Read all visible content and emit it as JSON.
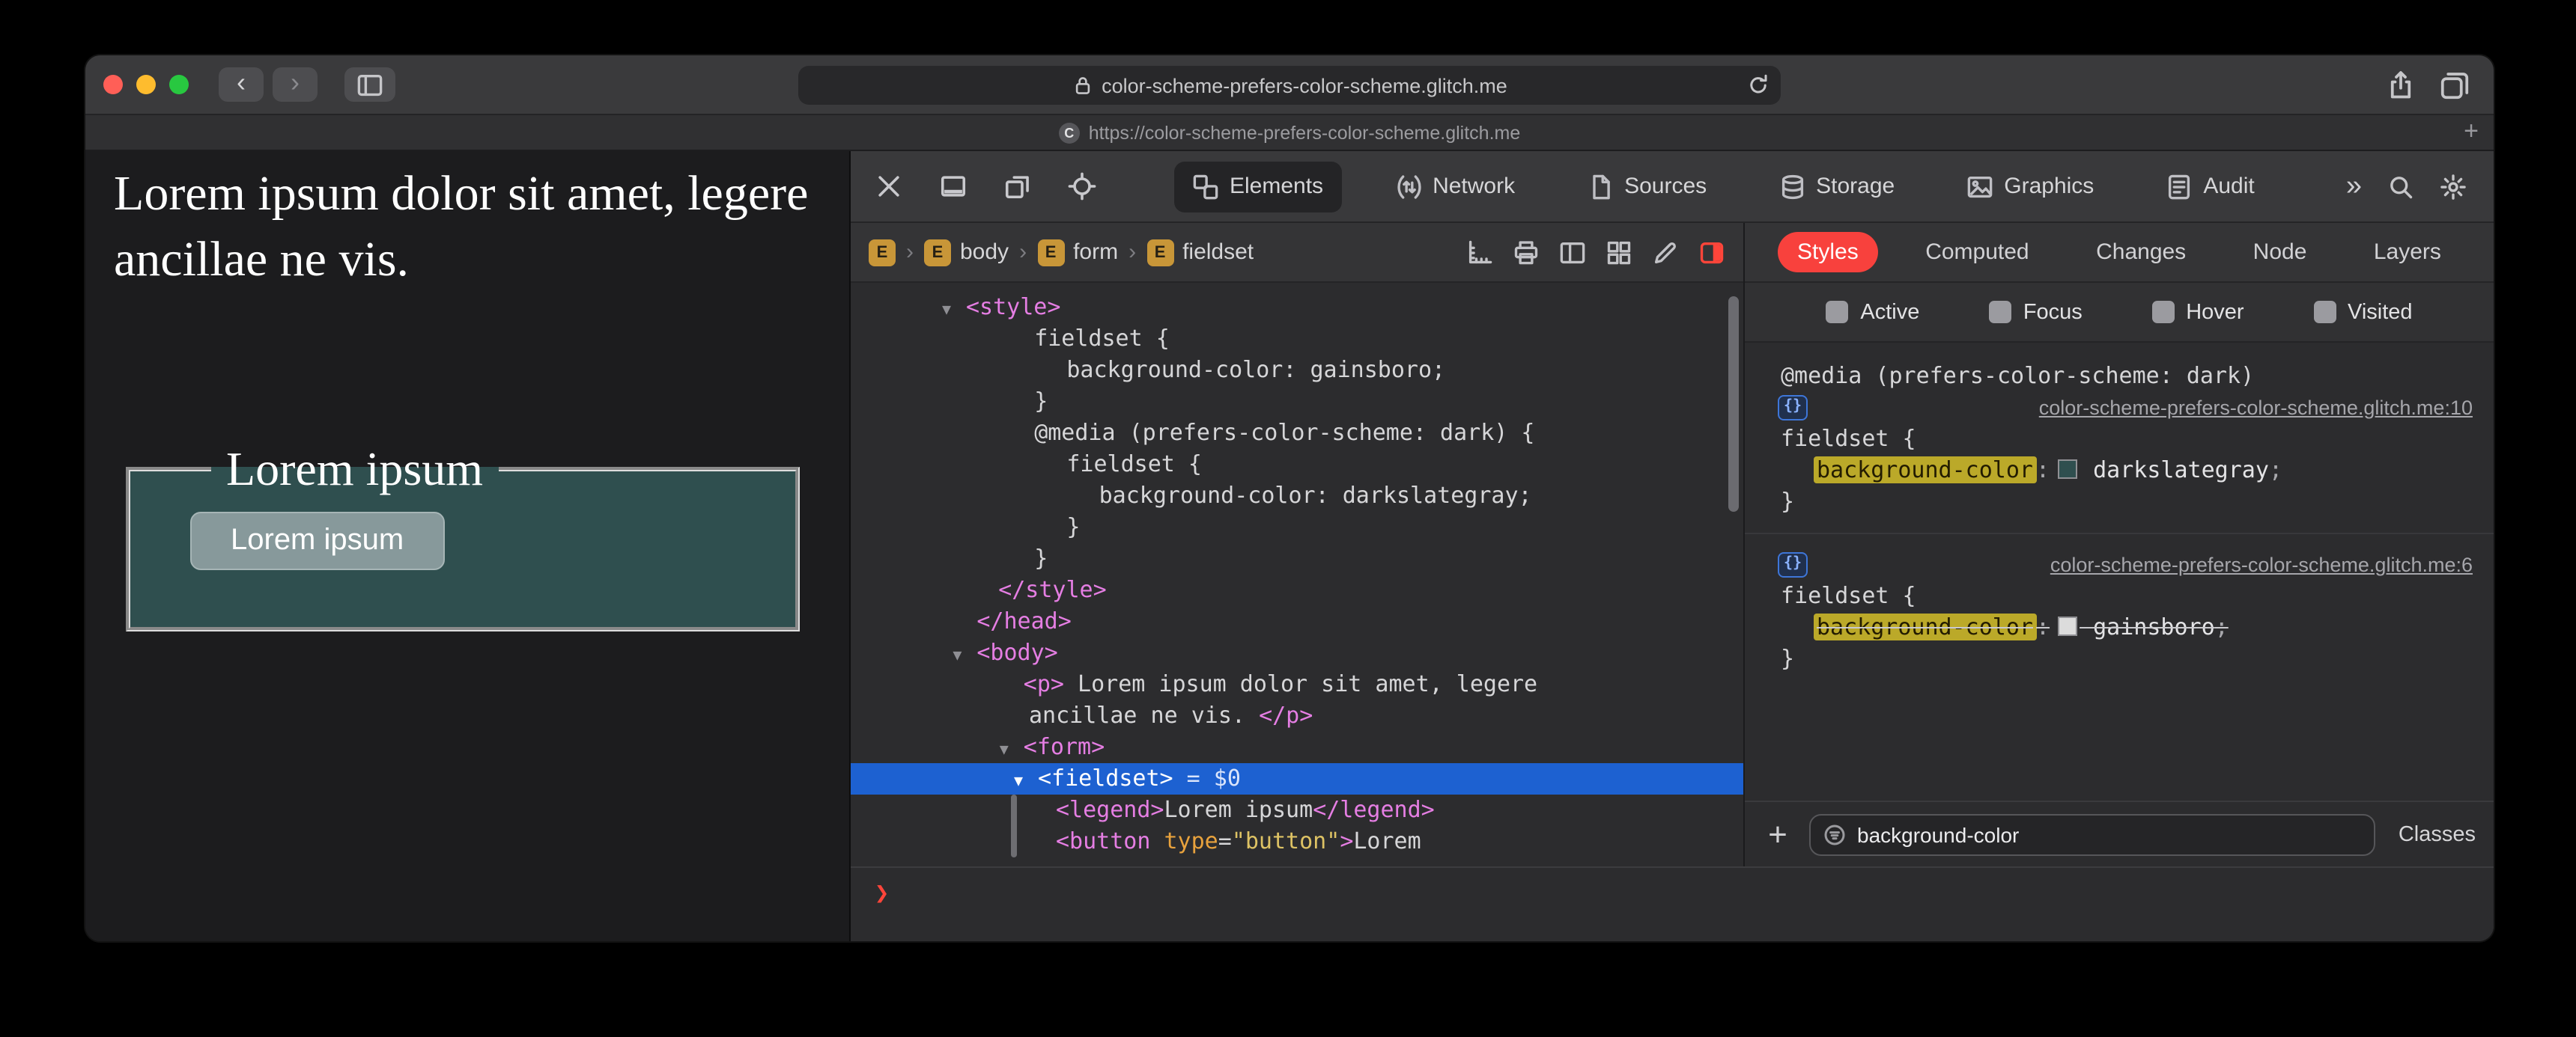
{
  "browser": {
    "traffic_lights": [
      {
        "name": "close-button",
        "color": "#ff5f57"
      },
      {
        "name": "minimize-button",
        "color": "#febc2e"
      },
      {
        "name": "zoom-button",
        "color": "#28c840"
      }
    ],
    "back": "‹",
    "forward": "›",
    "url": "color-scheme-prefers-color-scheme.glitch.me",
    "tab_title": "https://color-scheme-prefers-color-scheme.glitch.me",
    "favicon_letter": "C",
    "new_tab": "+"
  },
  "page": {
    "paragraph": "Lorem ipsum dolor sit amet, legere ancillae ne vis.",
    "legend": "Lorem ipsum",
    "button": "Lorem ipsum",
    "fieldset_bg": "#2f4f4f",
    "page_bg": "#1c1c1e"
  },
  "devtools": {
    "toolbar": {
      "left_icons": [
        {
          "name": "close-icon"
        },
        {
          "name": "dock-bottom-icon"
        },
        {
          "name": "dock-windows-icon"
        },
        {
          "name": "element-picker-icon"
        }
      ],
      "tabs": [
        {
          "label": "Elements",
          "icon": "elements-icon",
          "selected": true
        },
        {
          "label": "Network",
          "icon": "network-icon"
        },
        {
          "label": "Sources",
          "icon": "sources-icon"
        },
        {
          "label": "Storage",
          "icon": "storage-icon"
        },
        {
          "label": "Graphics",
          "icon": "graphics-icon"
        },
        {
          "label": "Audit",
          "icon": "audit-icon"
        }
      ],
      "overflow": "»",
      "right_icons": [
        {
          "name": "search-icon"
        },
        {
          "name": "settings-icon"
        }
      ]
    },
    "breadcrumb": {
      "badge": "E",
      "separator": "›",
      "items": [
        {
          "label": ""
        },
        {
          "label": "body"
        },
        {
          "label": "form"
        },
        {
          "label": "fieldset"
        }
      ],
      "right_icons": [
        {
          "name": "rulers-icon"
        },
        {
          "name": "print-icon"
        },
        {
          "name": "columns-icon"
        },
        {
          "name": "grid-icon"
        },
        {
          "name": "edit-icon"
        },
        {
          "name": "appearance-icon"
        }
      ]
    },
    "dom_tree": {
      "disclosure_glyph": "▼",
      "lines": [
        {
          "indent": 1,
          "disclosure": true,
          "segments": [
            {
              "t": "<style>",
              "c": "tag"
            }
          ]
        },
        {
          "indent": 2.9,
          "segments": [
            {
              "t": "fieldset {",
              "c": "plain"
            }
          ]
        },
        {
          "indent": 3.8,
          "segments": [
            {
              "t": "background-color: gainsboro;",
              "c": "plain"
            }
          ]
        },
        {
          "indent": 2.9,
          "segments": [
            {
              "t": "}",
              "c": "plain"
            }
          ]
        },
        {
          "indent": 2.9,
          "segments": [
            {
              "t": "@media (prefers-color-scheme: dark) {",
              "c": "plain"
            }
          ]
        },
        {
          "indent": 3.8,
          "segments": [
            {
              "t": "fieldset {",
              "c": "plain"
            }
          ]
        },
        {
          "indent": 4.7,
          "segments": [
            {
              "t": "background-color: darkslategray;",
              "c": "plain"
            }
          ]
        },
        {
          "indent": 3.8,
          "segments": [
            {
              "t": "}",
              "c": "plain"
            }
          ]
        },
        {
          "indent": 2.9,
          "segments": [
            {
              "t": "}",
              "c": "plain"
            }
          ]
        },
        {
          "indent": 1.9,
          "segments": [
            {
              "t": "</style>",
              "c": "tag"
            }
          ]
        },
        {
          "indent": 1.3,
          "segments": [
            {
              "t": "</head>",
              "c": "tag"
            }
          ]
        },
        {
          "indent": 1.3,
          "disclosure": true,
          "segments": [
            {
              "t": "<body>",
              "c": "tag"
            }
          ]
        },
        {
          "indent": 2.6,
          "segments": [
            {
              "t": "<p>",
              "c": "tag"
            },
            {
              "t": " Lorem ipsum dolor sit amet, legere",
              "c": "plain"
            }
          ]
        },
        {
          "indent": 2.75,
          "segments": [
            {
              "t": "ancillae ne vis. ",
              "c": "plain"
            },
            {
              "t": "</p>",
              "c": "tag"
            }
          ]
        },
        {
          "indent": 2.6,
          "disclosure": true,
          "segments": [
            {
              "t": "<form>",
              "c": "tag"
            }
          ]
        },
        {
          "indent": 3.0,
          "disclosure": true,
          "selected": true,
          "segments": [
            {
              "t": "<fieldset>",
              "c": "sel"
            },
            {
              "t": " = $0",
              "c": "seldim"
            }
          ]
        },
        {
          "indent": 3.5,
          "segments": [
            {
              "t": "<legend>",
              "c": "tag"
            },
            {
              "t": "Lorem ipsum",
              "c": "plain"
            },
            {
              "t": "</legend>",
              "c": "tag"
            }
          ]
        },
        {
          "indent": 3.5,
          "segments": [
            {
              "t": "<button ",
              "c": "tag"
            },
            {
              "t": "type",
              "c": "attr"
            },
            {
              "t": "=",
              "c": "plain"
            },
            {
              "t": "\"button\"",
              "c": "val"
            },
            {
              "t": ">",
              "c": "tag"
            },
            {
              "t": "Lorem",
              "c": "plain"
            }
          ]
        }
      ]
    },
    "console_prompt": "❯",
    "sidebar": {
      "tabs": [
        {
          "label": "Styles",
          "selected": true
        },
        {
          "label": "Computed"
        },
        {
          "label": "Changes"
        },
        {
          "label": "Node"
        },
        {
          "label": "Layers"
        }
      ],
      "pseudo": [
        "Active",
        "Focus",
        "Hover",
        "Visited"
      ],
      "rules": [
        {
          "media": "@media (prefers-color-scheme: dark)",
          "link": "color-scheme-prefers-color-scheme.glitch.me:10",
          "selector": "fieldset {",
          "declarations": [
            {
              "property": "background-color",
              "value": "darkslategray",
              "swatch": "#2f4f4f",
              "highlight": true,
              "struck": false
            }
          ],
          "close": "}"
        },
        {
          "link": "color-scheme-prefers-color-scheme.glitch.me:6",
          "selector": "fieldset {",
          "declarations": [
            {
              "property": "background-color",
              "value": "gainsboro",
              "swatch": "#dcdcdc",
              "highlight": true,
              "struck": true
            }
          ],
          "close": "}"
        }
      ],
      "add_button": "+",
      "filter_value": "background-color",
      "classes_label": "Classes"
    },
    "colors": {
      "selection_blue": "#1d61d1",
      "styles_tab_red": "#f8413d",
      "filter_highlight": "#bba929",
      "tag_pink": "#e57ee3",
      "attr_orange": "#e8a23d",
      "attr_value_yellow": "#ddc264",
      "prompt_red": "#ff453a"
    }
  }
}
